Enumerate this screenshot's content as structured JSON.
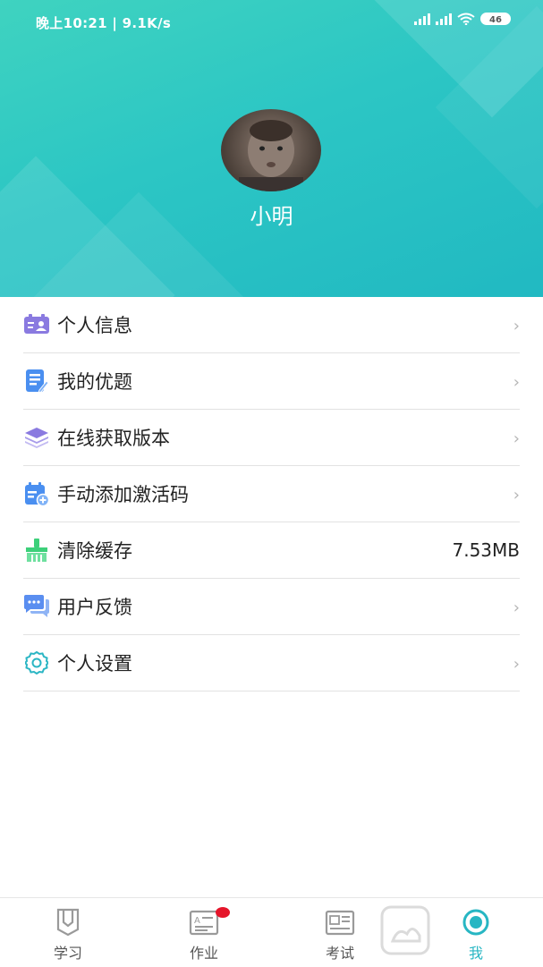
{
  "status_bar": {
    "time": "晚上10:21 | 9.1K/s",
    "battery": "46"
  },
  "profile": {
    "name": "小明"
  },
  "menu": [
    {
      "label": "个人信息",
      "icon": "id-card-icon",
      "color": "#8a7ae0"
    },
    {
      "label": "我的优题",
      "icon": "document-edit-icon",
      "color": "#4a8ff0"
    },
    {
      "label": "在线获取版本",
      "icon": "layers-icon",
      "color": "#8a7ae0"
    },
    {
      "label": "手动添加激活码",
      "icon": "calendar-add-icon",
      "color": "#4a8ff0"
    },
    {
      "label": "清除缓存",
      "icon": "broom-icon",
      "color": "#3dd07a",
      "value": "7.53MB"
    },
    {
      "label": "用户反馈",
      "icon": "chat-icon",
      "color": "#5a8ef0"
    },
    {
      "label": "个人设置",
      "icon": "gear-icon",
      "color": "#2bb6c4"
    }
  ],
  "tabs": [
    {
      "label": "学习",
      "icon": "book-icon"
    },
    {
      "label": "作业",
      "icon": "homework-icon",
      "badge": true
    },
    {
      "label": "考试",
      "icon": "exam-icon"
    },
    {
      "label": "我",
      "icon": "profile-icon",
      "active": true
    }
  ],
  "colors": {
    "accent": "#27b6c3",
    "header_start": "#3fd3c0",
    "header_end": "#21b9c2",
    "badge": "#e5152a"
  }
}
